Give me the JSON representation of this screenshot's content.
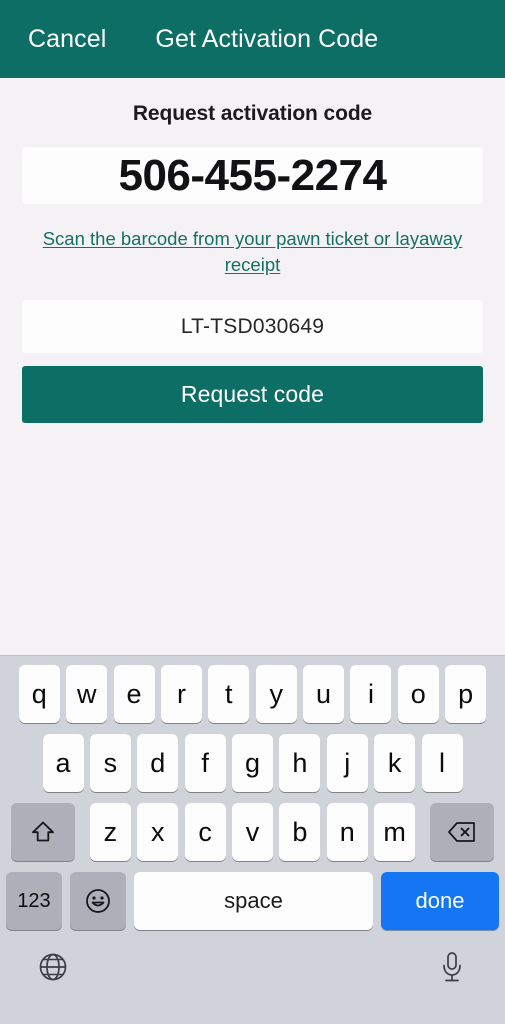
{
  "navbar": {
    "cancel_label": "Cancel",
    "title": "Get Activation Code",
    "background_color": "#0D6E66"
  },
  "form": {
    "section_title": "Request activation code",
    "phone_number": "506-455-2274",
    "scan_link_text": "Scan the barcode from your pawn ticket or layaway receipt",
    "scan_link_color": "#157065",
    "ticket_number": "LT-TSD030649",
    "request_button_label": "Request code",
    "request_button_color": "#0D6E66"
  },
  "keyboard": {
    "row1": [
      "q",
      "w",
      "e",
      "r",
      "t",
      "y",
      "u",
      "i",
      "o",
      "p"
    ],
    "row2": [
      "a",
      "s",
      "d",
      "f",
      "g",
      "h",
      "j",
      "k",
      "l"
    ],
    "row3": [
      "z",
      "x",
      "c",
      "v",
      "b",
      "n",
      "m"
    ],
    "shift_icon": "shift-arrow-icon",
    "backspace_icon": "backspace-icon",
    "numbers_label": "123",
    "emoji_icon": "smiley-face-icon",
    "space_label": "space",
    "done_label": "done",
    "done_color": "#1476F2",
    "globe_icon": "globe-icon",
    "microphone_icon": "microphone-icon",
    "background_color": "#D1D3DA"
  }
}
